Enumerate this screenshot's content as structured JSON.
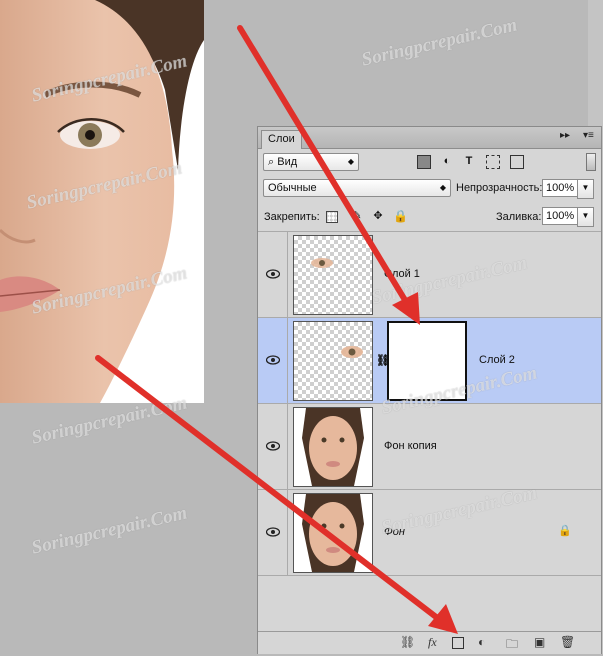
{
  "panel": {
    "tab_label": "Слои",
    "collapse_glyph": "▸▸",
    "menu_glyph": "▾≡"
  },
  "filter": {
    "kind_label": "Вид",
    "search_icon_glyph": "⌕"
  },
  "blend": {
    "mode": "Обычные",
    "opacity_label": "Непрозрачность:",
    "opacity_value": "100%"
  },
  "lock": {
    "label": "Закрепить:",
    "fill_label": "Заливка:",
    "fill_value": "100%"
  },
  "layers": [
    {
      "name": "Слой 1",
      "visible": true,
      "selected": false,
      "locked": false
    },
    {
      "name": "Слой 2",
      "visible": true,
      "selected": true,
      "locked": false,
      "has_mask": true
    },
    {
      "name": "Фон копия",
      "visible": true,
      "selected": false,
      "locked": false
    },
    {
      "name": "Фон",
      "visible": true,
      "selected": false,
      "locked": true
    }
  ],
  "bottom_bar": {
    "fx_label": "fx"
  },
  "watermark": "Soringpcrepair.Com",
  "colors": {
    "selection": "#b9cbf5",
    "arrow": "#e0302a",
    "panel_bg": "#d6d6d6"
  }
}
